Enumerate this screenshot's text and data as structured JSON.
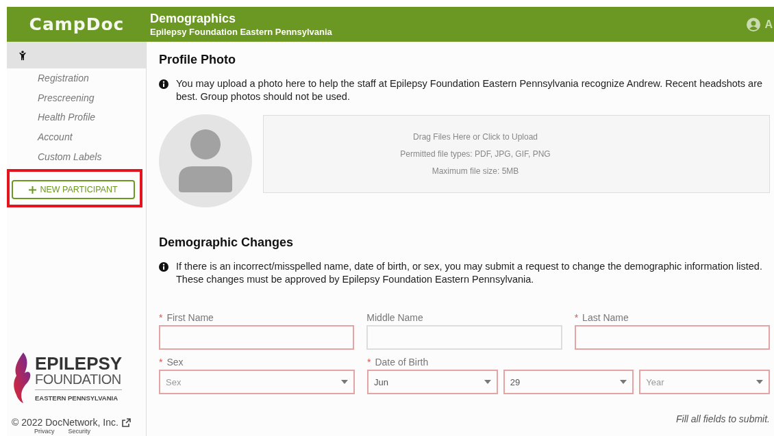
{
  "header": {
    "logo": "CampDoc",
    "title": "Demographics",
    "subtitle": "Epilepsy Foundation Eastern Pennsylvania",
    "user": "A"
  },
  "sidebar": {
    "items": [
      {
        "label": "Registration"
      },
      {
        "label": "Prescreening"
      },
      {
        "label": "Health Profile"
      },
      {
        "label": "Account"
      },
      {
        "label": "Custom Labels"
      }
    ],
    "new_button": "NEW PARTICIPANT",
    "highlighted": true,
    "org_logo": {
      "line_1": "EPILEPSY",
      "line_2": "FOUNDATION",
      "line_3": "EASTERN PENNSYLVANIA"
    },
    "copyright": "© 2022 DocNetwork, Inc.",
    "links": [
      "Privacy",
      "Security"
    ]
  },
  "profile_photo": {
    "heading": "Profile Photo",
    "info": "You may upload a photo here to help the staff at Epilepsy Foundation Eastern Pennsylvania recognize Andrew. Recent headshots are best. Group photos should not be used.",
    "upload_lines": [
      "Drag Files Here or Click to Upload",
      "Permitted file types: PDF, JPG, GIF, PNG",
      "Maximum file size: 5MB"
    ]
  },
  "demographic_changes": {
    "heading": "Demographic Changes",
    "info": "If there is an incorrect/misspelled name, date of birth, or sex, you may submit a request to change the demographic information listed. These changes must be approved by Epilepsy Foundation Eastern Pennsylvania.",
    "required_mark": "*",
    "name_fields": [
      {
        "label": "First Name",
        "required": true
      },
      {
        "label": "Middle Name",
        "required": false
      },
      {
        "label": "Last Name",
        "required": true
      }
    ],
    "sex": {
      "label": "Sex",
      "required": true,
      "placeholder": "Sex"
    },
    "dob": {
      "label": "Date of Birth",
      "required": true,
      "selects": [
        {
          "value": "Jun"
        },
        {
          "value": "29"
        },
        {
          "placeholder": "Year"
        }
      ]
    },
    "footer_note": "Fill all fields to submit."
  }
}
